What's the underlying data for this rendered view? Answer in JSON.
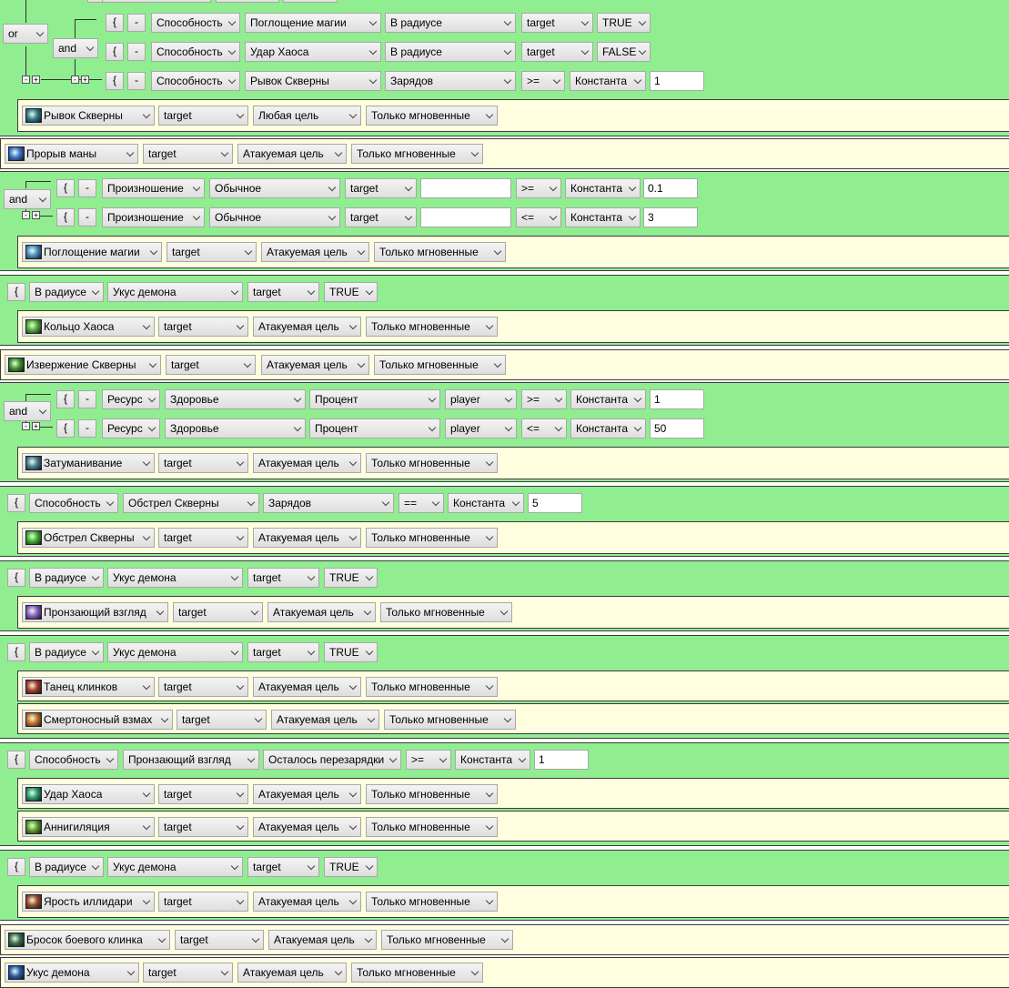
{
  "ui": {
    "open": "{",
    "minus": "-",
    "plus": "+"
  },
  "blocks": [
    {
      "conds": [
        [
          "Способность",
          "Поглощение магии",
          "В радиусе",
          "target",
          "TRUE"
        ],
        [
          "Способность",
          "Удар Хаоса",
          "В радиусе",
          "target",
          "FALSE"
        ],
        [
          "Способность",
          "Рывок Скверны",
          "Зарядов",
          ">=",
          "Константа",
          "1"
        ]
      ],
      "ops": [
        "or",
        "and"
      ],
      "actions": [
        [
          "Рывок Скверны",
          "target",
          "Любая цель",
          "Только мгновенные"
        ]
      ]
    },
    {
      "actions": [
        [
          "Прорыв маны",
          "target",
          "Атакуемая цель",
          "Только мгновенные"
        ]
      ]
    },
    {
      "ops": [
        "and"
      ],
      "conds": [
        [
          "Произношение",
          "Обычное",
          "target",
          "",
          ">=",
          "Константа",
          "0.1"
        ],
        [
          "Произношение",
          "Обычное",
          "target",
          "",
          "<=",
          "Константа",
          "3"
        ]
      ],
      "actions": [
        [
          "Поглощение магии",
          "target",
          "Атакуемая цель",
          "Только мгновенные"
        ]
      ]
    },
    {
      "conds": [
        [
          "В радиусе",
          "Укус демона",
          "target",
          "TRUE"
        ]
      ],
      "actions": [
        [
          "Кольцо Хаоса",
          "target",
          "Атакуемая цель",
          "Только мгновенные"
        ]
      ]
    },
    {
      "actions": [
        [
          "Извержение Скверны",
          "target",
          "Атакуемая цель",
          "Только мгновенные"
        ]
      ]
    },
    {
      "ops": [
        "and"
      ],
      "conds": [
        [
          "Ресурс",
          "Здоровье",
          "Процент",
          "player",
          ">=",
          "Константа",
          "1"
        ],
        [
          "Ресурс",
          "Здоровье",
          "Процент",
          "player",
          "<=",
          "Константа",
          "50"
        ]
      ],
      "actions": [
        [
          "Затуманивание",
          "target",
          "Атакуемая цель",
          "Только мгновенные"
        ]
      ]
    },
    {
      "conds": [
        [
          "Способность",
          "Обстрел Скверны",
          "Зарядов",
          "==",
          "Константа",
          "5"
        ]
      ],
      "actions": [
        [
          "Обстрел Скверны",
          "target",
          "Атакуемая цель",
          "Только мгновенные"
        ]
      ]
    },
    {
      "conds": [
        [
          "В радиусе",
          "Укус демона",
          "target",
          "TRUE"
        ]
      ],
      "actions": [
        [
          "Пронзающий взгляд",
          "target",
          "Атакуемая цель",
          "Только мгновенные"
        ]
      ]
    },
    {
      "conds": [
        [
          "В радиусе",
          "Укус демона",
          "target",
          "TRUE"
        ]
      ],
      "actions": [
        [
          "Танец клинков",
          "target",
          "Атакуемая цель",
          "Только мгновенные"
        ],
        [
          "Смертоносный взмах",
          "target",
          "Атакуемая цель",
          "Только мгновенные"
        ]
      ]
    },
    {
      "conds": [
        [
          "Способность",
          "Пронзающий взгляд",
          "Осталось перезарядки",
          ">=",
          "Константа",
          "1"
        ]
      ],
      "actions": [
        [
          "Удар Хаоса",
          "target",
          "Атакуемая цель",
          "Только мгновенные"
        ],
        [
          "Аннигиляция",
          "target",
          "Атакуемая цель",
          "Только мгновенные"
        ]
      ]
    },
    {
      "conds": [
        [
          "В радиусе",
          "Укус демона",
          "target",
          "TRUE"
        ]
      ],
      "actions": [
        [
          "Ярость иллидари",
          "target",
          "Атакуемая цель",
          "Только мгновенные"
        ]
      ]
    },
    {
      "actions": [
        [
          "Бросок боевого клинка",
          "target",
          "Атакуемая цель",
          "Только мгновенные"
        ]
      ]
    },
    {
      "actions": [
        [
          "Укус демона",
          "target",
          "Атакуемая цель",
          "Только мгновенные"
        ]
      ]
    }
  ],
  "icon_colors": {
    "fel-rush-icon": "#2e7a8a",
    "mana-break-icon": "#3a6fd0",
    "consume-magic-icon": "#4a8cc4",
    "chaos-nova-icon": "#4fa83a",
    "fel-eruption-icon": "#3d8f2a",
    "blur-icon": "#4a7890",
    "fel-barrage-icon": "#3fae2e",
    "eye-beam-icon": "#8a5cc8",
    "blade-dance-icon": "#a83a2e",
    "death-sweep-icon": "#c4702a",
    "chaos-strike-icon": "#2a9a6a",
    "annihilation-icon": "#5a9a2a",
    "metamorphosis-icon": "#9a4a2a",
    "throw-glaive-icon": "#3a6a4a",
    "demons-bite-icon": "#2a5ab0"
  }
}
